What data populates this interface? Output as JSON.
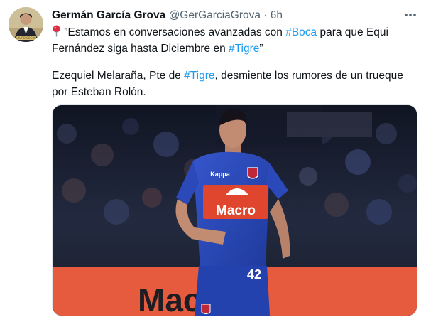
{
  "tweet": {
    "author_name": "Germán García Grova",
    "author_handle": "@GerGarciaGrova",
    "separator": "·",
    "time": "6h",
    "more_icon": "more-dots-icon",
    "pin_icon": "round-pushpin-icon",
    "line1": {
      "before": " ”Estamos en conversaciones avanzadas con ",
      "hashtag1": "#Boca",
      "middle": " para que Equi Fernández siga hasta Diciembre en ",
      "hashtag2": "#Tigre",
      "after": "”"
    },
    "line2": {
      "before": "Ezequiel Melaraña, Pte de ",
      "hashtag": "#Tigre",
      "after": ", desmiente los rumores de un trueque por Esteban Rolón."
    },
    "media": {
      "jersey_sponsor": "Macro",
      "jersey_number": "42",
      "kit_brand": "Kappa",
      "sign_text": "Macro"
    }
  },
  "colors": {
    "link": "#1d9bf0",
    "muted": "#536471",
    "text": "#0f1419",
    "jersey_blue": "#2b49b8",
    "sponsor_red": "#e0452e"
  }
}
